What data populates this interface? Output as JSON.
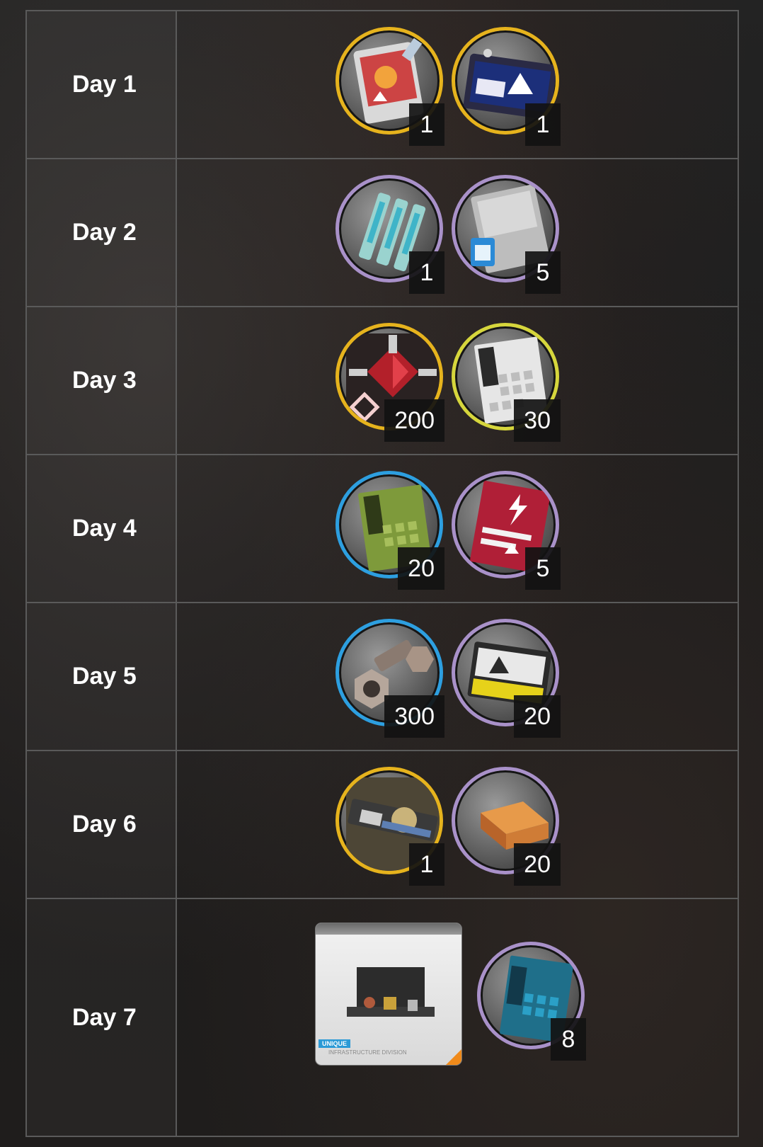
{
  "days": [
    {
      "label": "Day 1",
      "items": [
        {
          "icon": "operator-token-icon",
          "rarity": "gold",
          "count": "1"
        },
        {
          "icon": "headhunting-permit-icon",
          "rarity": "gold",
          "count": "1"
        }
      ]
    },
    {
      "label": "Day 2",
      "items": [
        {
          "icon": "advanced-catalyst-icon",
          "rarity": "purple",
          "count": "1"
        },
        {
          "icon": "furniture-parts-icon",
          "rarity": "purple",
          "count": "5"
        }
      ]
    },
    {
      "label": "Day 3",
      "items": [
        {
          "icon": "originium-shard-icon",
          "rarity": "gold",
          "count": "200"
        },
        {
          "icon": "skill-summary-1-icon",
          "rarity": "yellow",
          "count": "30"
        }
      ]
    },
    {
      "label": "Day 4",
      "items": [
        {
          "icon": "skill-summary-2-icon",
          "rarity": "blue",
          "count": "20"
        },
        {
          "icon": "expedited-plan-icon",
          "rarity": "purple",
          "count": "5"
        }
      ]
    },
    {
      "label": "Day 5",
      "items": [
        {
          "icon": "device-bolt-nut-icon",
          "rarity": "blue",
          "count": "300"
        },
        {
          "icon": "battle-record-icon",
          "rarity": "purple",
          "count": "20"
        }
      ]
    },
    {
      "label": "Day 6",
      "items": [
        {
          "icon": "recruitment-permit-icon",
          "rarity": "gold",
          "count": "1"
        },
        {
          "icon": "gold-bar-icon",
          "rarity": "purple",
          "count": "20"
        }
      ]
    },
    {
      "label": "Day 7",
      "items": [
        {
          "icon": "skill-summary-3-icon",
          "rarity": "purple",
          "count": "8"
        }
      ],
      "furniture_card": {
        "icon": "furniture-set-card-icon",
        "tag": "UNIQUE",
        "subtitle": "INFRASTRUCTURE DIVISION"
      }
    }
  ],
  "colors": {
    "gold": "#e6b31d",
    "purple": "#a991c9",
    "yellow": "#d6d63c",
    "blue": "#2d9fe0",
    "grid": "#5a5a5a"
  }
}
